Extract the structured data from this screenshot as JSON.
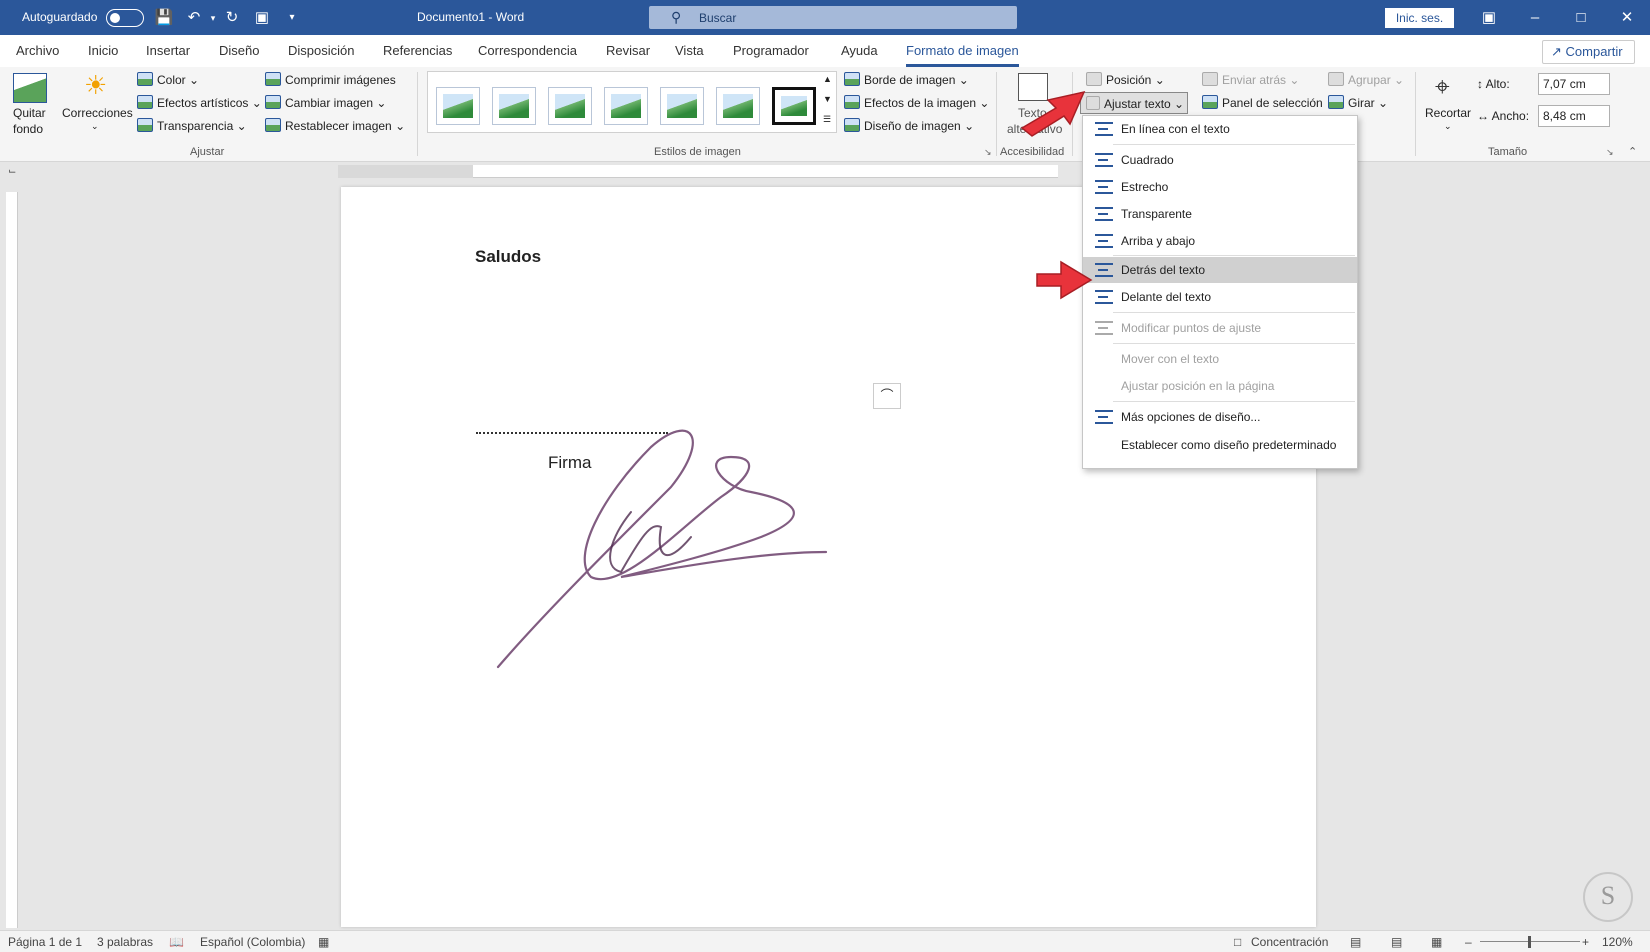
{
  "titlebar": {
    "autosave_label": "Autoguardado",
    "doc_title": "Documento1 - Word",
    "search_placeholder": "Buscar",
    "signin_label": "Inic. ses."
  },
  "tabs": [
    {
      "label": "Archivo"
    },
    {
      "label": "Inicio"
    },
    {
      "label": "Insertar"
    },
    {
      "label": "Diseño"
    },
    {
      "label": "Disposición"
    },
    {
      "label": "Referencias"
    },
    {
      "label": "Correspondencia"
    },
    {
      "label": "Revisar"
    },
    {
      "label": "Vista"
    },
    {
      "label": "Programador"
    },
    {
      "label": "Ayuda"
    },
    {
      "label": "Formato de imagen"
    }
  ],
  "share_label": "Compartir",
  "ribbon": {
    "ajustar": {
      "quitar_fondo_1": "Quitar",
      "quitar_fondo_2": "fondo",
      "correcciones": "Correcciones",
      "color": "Color",
      "efectos_artisticos": "Efectos artísticos",
      "transparencia": "Transparencia",
      "comprimir": "Comprimir imágenes",
      "cambiar": "Cambiar imagen",
      "restablecer": "Restablecer imagen",
      "group_label": "Ajustar"
    },
    "estilos": {
      "borde": "Borde de imagen",
      "efectos": "Efectos de la imagen",
      "diseno": "Diseño de imagen",
      "group_label": "Estilos de imagen"
    },
    "accesibilidad": {
      "texto_alt_1": "Texto",
      "texto_alt_2": "alternativo",
      "group_label": "Accesibilidad"
    },
    "organizar": {
      "posicion": "Posición",
      "ajustar_texto": "Ajustar texto",
      "enviar_atras": "Enviar atrás",
      "panel_seleccion": "Panel de selección",
      "agrupar": "Agrupar",
      "girar": "Girar"
    },
    "tamano": {
      "recortar": "Recortar",
      "alto_label": "Alto:",
      "alto_value": "7,07 cm",
      "ancho_label": "Ancho:",
      "ancho_value": "8,48 cm",
      "group_label": "Tamaño"
    }
  },
  "document": {
    "saludos": "Saludos",
    "firma": "Firma"
  },
  "wrap_menu": {
    "items": [
      {
        "label": "En línea con el texto",
        "enabled": true
      },
      {
        "label": "Cuadrado",
        "enabled": true
      },
      {
        "label": "Estrecho",
        "enabled": true
      },
      {
        "label": "Transparente",
        "enabled": true
      },
      {
        "label": "Arriba y abajo",
        "enabled": true
      },
      {
        "label": "Detrás del texto",
        "enabled": true,
        "highlighted": true
      },
      {
        "label": "Delante del texto",
        "enabled": true
      },
      {
        "label": "Modificar puntos de ajuste",
        "enabled": false
      },
      {
        "label": "Mover con el texto",
        "enabled": false
      },
      {
        "label": "Ajustar posición en la página",
        "enabled": false
      },
      {
        "label": "Más opciones de diseño...",
        "enabled": true
      },
      {
        "label": "Establecer como diseño predeterminado",
        "enabled": true
      }
    ]
  },
  "statusbar": {
    "page": "Página 1 de 1",
    "words": "3 palabras",
    "language": "Español (Colombia)",
    "focus": "Concentración",
    "zoom": "120%"
  },
  "colors": {
    "brand": "#2b579a",
    "arrow": "#e8333b"
  }
}
